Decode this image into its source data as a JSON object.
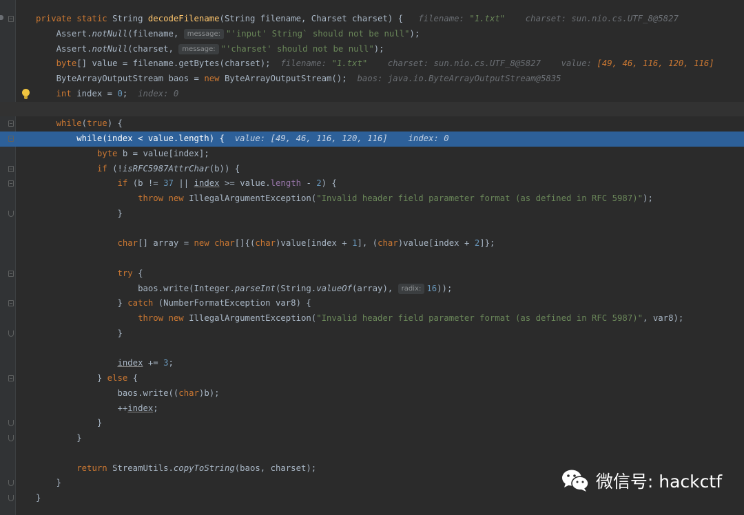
{
  "editor": {
    "lines": [
      [
        {
          "t": "private static ",
          "c": "kw"
        },
        {
          "t": "String "
        },
        {
          "t": "decodeFilename",
          "c": "fn"
        },
        {
          "t": "(String filename, Charset charset) {   "
        },
        {
          "t": "filename: ",
          "c": "hint"
        },
        {
          "t": "\"1.txt\"",
          "c": "hint-str"
        },
        {
          "t": "    charset: sun.nio.cs.UTF_8@5827",
          "c": "hint"
        }
      ],
      [
        {
          "t": "    Assert."
        },
        {
          "t": "notNull",
          "c": "st"
        },
        {
          "t": "(filename, "
        },
        {
          "t": "message:",
          "c": "pill"
        },
        {
          "t": "\"'input' String` should not be null\"",
          "c": "str"
        },
        {
          "t": ");"
        }
      ],
      [
        {
          "t": "    Assert."
        },
        {
          "t": "notNull",
          "c": "st"
        },
        {
          "t": "(charset, "
        },
        {
          "t": "message:",
          "c": "pill"
        },
        {
          "t": "\"'charset' should not be null\"",
          "c": "str"
        },
        {
          "t": ");"
        }
      ],
      [
        {
          "t": "    "
        },
        {
          "t": "byte",
          "c": "kw"
        },
        {
          "t": "[] value = filename.getBytes(charset);  "
        },
        {
          "t": "filename: ",
          "c": "hint"
        },
        {
          "t": "\"1.txt\"",
          "c": "hint-str"
        },
        {
          "t": "    charset: sun.nio.cs.UTF_8@5827    value: ",
          "c": "hint"
        },
        {
          "t": "[49, 46, 116, 120, 116]",
          "c": "hint-arr"
        }
      ],
      [
        {
          "t": "    ByteArrayOutputStream baos = "
        },
        {
          "t": "new ",
          "c": "kw"
        },
        {
          "t": "ByteArrayOutputStream();  "
        },
        {
          "t": "baos: java.io.ByteArrayOutputStream@5835",
          "c": "hint"
        }
      ],
      [
        {
          "t": "    "
        },
        {
          "t": "int ",
          "c": "kw"
        },
        {
          "t": "index = "
        },
        {
          "t": "0",
          "c": "num"
        },
        {
          "t": ";  "
        },
        {
          "t": "index: 0",
          "c": "hint"
        }
      ],
      [],
      [
        {
          "t": "    "
        },
        {
          "t": "while",
          "c": "kw"
        },
        {
          "t": "("
        },
        {
          "t": "true",
          "c": "kw"
        },
        {
          "t": ") {"
        }
      ],
      [
        {
          "t": "        while(index < value.length) {  "
        },
        {
          "t": "value: [49, 46, 116, 120, 116]    index: 0",
          "c": "hint"
        }
      ],
      [
        {
          "t": "            "
        },
        {
          "t": "byte ",
          "c": "kw"
        },
        {
          "t": "b = value[index];"
        }
      ],
      [
        {
          "t": "            "
        },
        {
          "t": "if ",
          "c": "kw"
        },
        {
          "t": "(!"
        },
        {
          "t": "isRFC5987AttrChar",
          "c": "st"
        },
        {
          "t": "(b)) {"
        }
      ],
      [
        {
          "t": "                "
        },
        {
          "t": "if ",
          "c": "kw"
        },
        {
          "t": "(b != "
        },
        {
          "t": "37",
          "c": "num"
        },
        {
          "t": " || "
        },
        {
          "t": "index",
          "c": "ul"
        },
        {
          "t": " >= value."
        },
        {
          "t": "length",
          "c": "fld"
        },
        {
          "t": " - "
        },
        {
          "t": "2",
          "c": "num"
        },
        {
          "t": ") {"
        }
      ],
      [
        {
          "t": "                    "
        },
        {
          "t": "throw new ",
          "c": "kw"
        },
        {
          "t": "IllegalArgumentException("
        },
        {
          "t": "\"Invalid header field parameter format (as defined in RFC 5987)\"",
          "c": "str"
        },
        {
          "t": ");"
        }
      ],
      [
        {
          "t": "                }"
        }
      ],
      [],
      [
        {
          "t": "                "
        },
        {
          "t": "char",
          "c": "kw"
        },
        {
          "t": "[] array = "
        },
        {
          "t": "new ",
          "c": "kw"
        },
        {
          "t": "char",
          "c": "kw"
        },
        {
          "t": "[]{("
        },
        {
          "t": "char",
          "c": "kw"
        },
        {
          "t": ")value[index + "
        },
        {
          "t": "1",
          "c": "num"
        },
        {
          "t": "], ("
        },
        {
          "t": "char",
          "c": "kw"
        },
        {
          "t": ")value[index + "
        },
        {
          "t": "2",
          "c": "num"
        },
        {
          "t": "]};"
        }
      ],
      [],
      [
        {
          "t": "                "
        },
        {
          "t": "try ",
          "c": "kw"
        },
        {
          "t": "{"
        }
      ],
      [
        {
          "t": "                    baos.write(Integer."
        },
        {
          "t": "parseInt",
          "c": "st"
        },
        {
          "t": "(String."
        },
        {
          "t": "valueOf",
          "c": "st"
        },
        {
          "t": "(array), "
        },
        {
          "t": "radix:",
          "c": "pill"
        },
        {
          "t": "16",
          "c": "num"
        },
        {
          "t": "));"
        }
      ],
      [
        {
          "t": "                } "
        },
        {
          "t": "catch ",
          "c": "kw"
        },
        {
          "t": "(NumberFormatException var8) {"
        }
      ],
      [
        {
          "t": "                    "
        },
        {
          "t": "throw new ",
          "c": "kw"
        },
        {
          "t": "IllegalArgumentException("
        },
        {
          "t": "\"Invalid header field parameter format (as defined in RFC 5987)\"",
          "c": "str"
        },
        {
          "t": ", var8);"
        }
      ],
      [
        {
          "t": "                }"
        }
      ],
      [],
      [
        {
          "t": "                "
        },
        {
          "t": "index",
          "c": "ul"
        },
        {
          "t": " += "
        },
        {
          "t": "3",
          "c": "num"
        },
        {
          "t": ";"
        }
      ],
      [
        {
          "t": "            } "
        },
        {
          "t": "else ",
          "c": "kw"
        },
        {
          "t": "{"
        }
      ],
      [
        {
          "t": "                baos.write(("
        },
        {
          "t": "char",
          "c": "kw"
        },
        {
          "t": ")b);"
        }
      ],
      [
        {
          "t": "                ++"
        },
        {
          "t": "index",
          "c": "ul"
        },
        {
          "t": ";"
        }
      ],
      [
        {
          "t": "            }"
        }
      ],
      [
        {
          "t": "        }"
        }
      ],
      [],
      [
        {
          "t": "        "
        },
        {
          "t": "return ",
          "c": "kw"
        },
        {
          "t": "StreamUtils."
        },
        {
          "t": "copyToString",
          "c": "st"
        },
        {
          "t": "(baos, charset);"
        }
      ],
      [
        {
          "t": "    }"
        }
      ],
      [
        {
          "t": "}"
        }
      ]
    ],
    "caret_line": 6,
    "exec_line": 8,
    "bulb_line": 5,
    "folds": [
      {
        "line": 0,
        "kind": "open"
      },
      {
        "line": 7,
        "kind": "open"
      },
      {
        "line": 8,
        "kind": "open"
      },
      {
        "line": 10,
        "kind": "open"
      },
      {
        "line": 11,
        "kind": "open"
      },
      {
        "line": 13,
        "kind": "end"
      },
      {
        "line": 17,
        "kind": "open"
      },
      {
        "line": 19,
        "kind": "open"
      },
      {
        "line": 21,
        "kind": "end"
      },
      {
        "line": 24,
        "kind": "open"
      },
      {
        "line": 27,
        "kind": "end"
      },
      {
        "line": 28,
        "kind": "end"
      },
      {
        "line": 31,
        "kind": "end"
      },
      {
        "line": 32,
        "kind": "end"
      }
    ]
  },
  "watermark": {
    "text": "微信号: hackctf",
    "icon": "wechat-icon"
  }
}
